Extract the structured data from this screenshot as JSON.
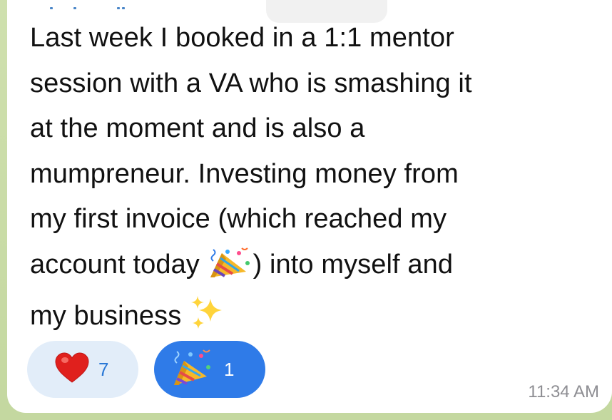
{
  "message": {
    "line1": "Last week I booked in a 1:1 mentor",
    "line2": "session with a VA who is smashing it",
    "line3": "at the moment and is also a",
    "line4": "mumpreneur. Investing money from",
    "line5": "my first invoice (which reached my",
    "line6_before": "account today ",
    "line6_after": ") into myself and",
    "line7": "my business ",
    "inline_emojis": [
      "party-popper-icon",
      "sparkles-icon"
    ]
  },
  "reactions": [
    {
      "icon": "heart-icon",
      "count": "7",
      "color": "#e2edf9",
      "selected": false
    },
    {
      "icon": "party-popper-icon",
      "count": "1",
      "color": "#2f7be8",
      "selected": true
    }
  ],
  "timestamp": "11:34 AM",
  "colors": {
    "bubble": "#ffffff",
    "wallpaper": "#c9dba8",
    "text": "#111111",
    "timestamp": "#8e8e93",
    "selected_reaction": "#2f7be8",
    "reaction": "#e2edf9"
  }
}
